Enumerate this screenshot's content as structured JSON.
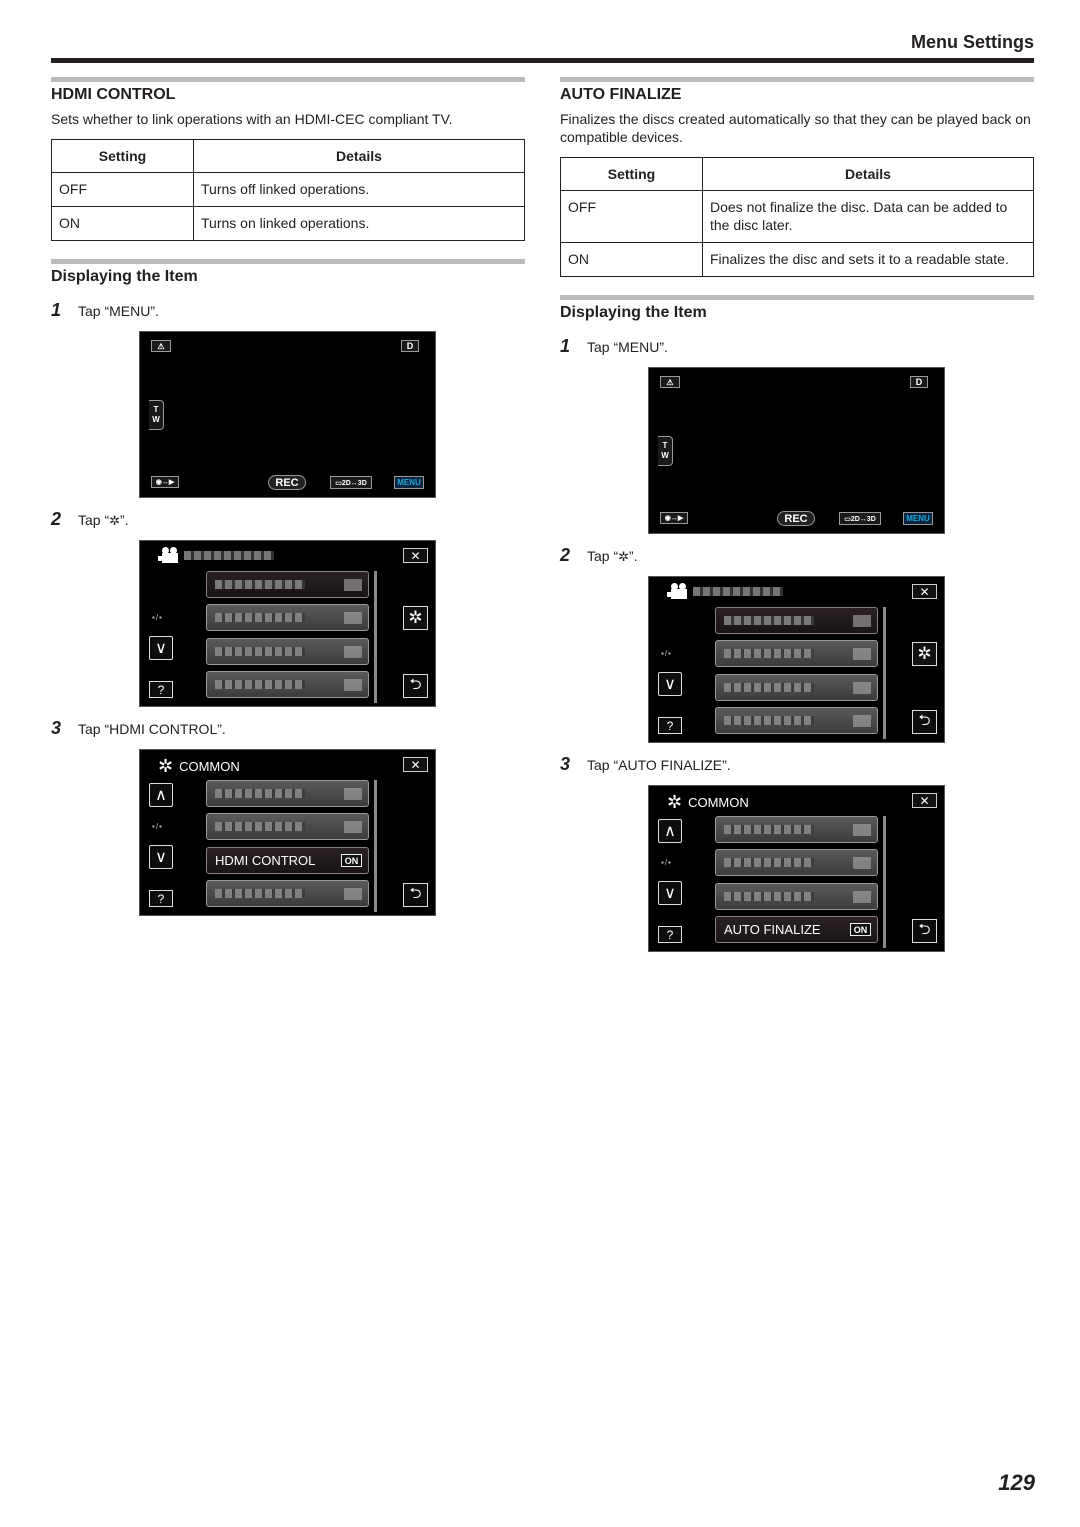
{
  "header": {
    "title": "Menu Settings"
  },
  "page_number": "129",
  "left": {
    "section_title": "HDMI CONTROL",
    "description": "Sets whether to link operations with an HDMI-CEC compliant TV.",
    "table": {
      "headers": [
        "Setting",
        "Details"
      ],
      "rows": [
        {
          "setting": "OFF",
          "details": "Turns off linked operations."
        },
        {
          "setting": "ON",
          "details": "Turns on linked operations."
        }
      ]
    },
    "sub_title": "Displaying the Item",
    "steps": [
      {
        "num": "1",
        "prefix": "Tap “MENU”."
      },
      {
        "num": "2",
        "prefix": "Tap “",
        "suffix": "”."
      },
      {
        "num": "3",
        "prefix": "Tap “HDMI CONTROL”."
      }
    ],
    "menu_item_label": "HDMI CONTROL"
  },
  "right": {
    "section_title": "AUTO FINALIZE",
    "description": "Finalizes the discs created automatically so that they can be played back on compatible devices.",
    "table": {
      "headers": [
        "Setting",
        "Details"
      ],
      "rows": [
        {
          "setting": "OFF",
          "details": "Does not finalize the disc. Data can be added to the disc later."
        },
        {
          "setting": "ON",
          "details": "Finalizes the disc and sets it to a readable state."
        }
      ]
    },
    "sub_title": "Displaying the Item",
    "steps": [
      {
        "num": "1",
        "prefix": "Tap “MENU”."
      },
      {
        "num": "2",
        "prefix": "Tap “",
        "suffix": "”."
      },
      {
        "num": "3",
        "prefix": "Tap “AUTO FINALIZE”."
      }
    ],
    "menu_item_label": "AUTO FINALIZE"
  },
  "screen": {
    "tw_top": "T",
    "tw_bottom": "W",
    "d_label": "D",
    "rec_label": "REC",
    "mode_label": "▭2D↔3D",
    "menu_label": "MENU",
    "common_label": "COMMON",
    "on_badge": "ON",
    "gear_glyph": "✲",
    "close_glyph": "✕",
    "help_glyph": "?",
    "back_glyph": "⮌",
    "up_glyph": "∧",
    "down_glyph": "∨",
    "page_indicator": "▪/▪",
    "accent_menu_color": "#1aa8d8"
  }
}
